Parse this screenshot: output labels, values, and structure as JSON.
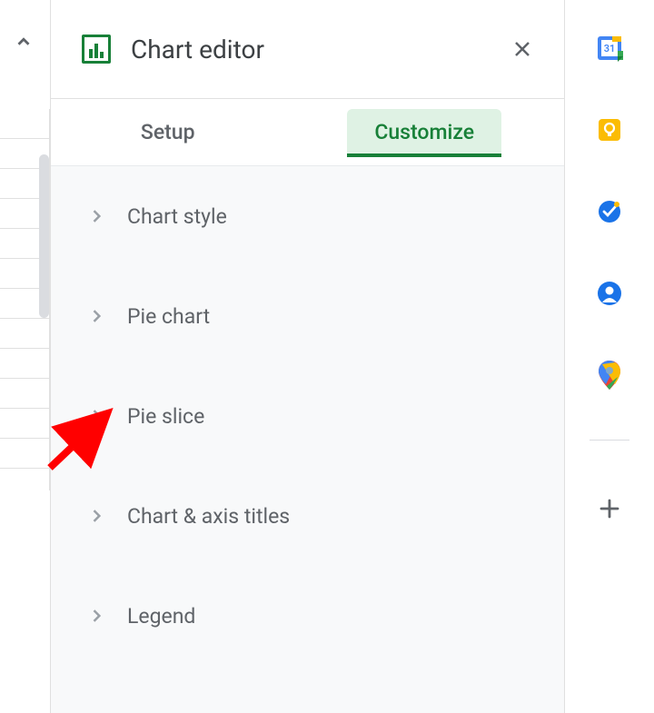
{
  "header": {
    "title": "Chart editor"
  },
  "tabs": {
    "setup": "Setup",
    "customize": "Customize"
  },
  "sections": [
    {
      "label": "Chart style"
    },
    {
      "label": "Pie chart"
    },
    {
      "label": "Pie slice"
    },
    {
      "label": "Chart & axis titles"
    },
    {
      "label": "Legend"
    }
  ],
  "rail": {
    "calendar_day": "31"
  }
}
